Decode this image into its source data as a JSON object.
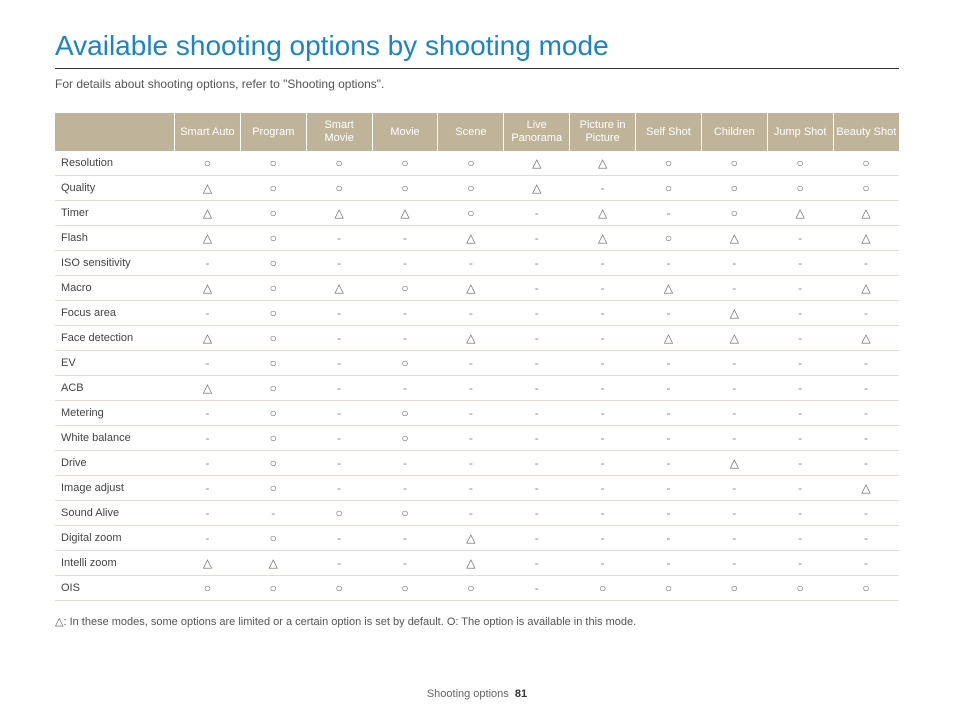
{
  "title": "Available shooting options by shooting mode",
  "subtitle": "For details about shooting options, refer to \"Shooting options\".",
  "columns": [
    "Smart Auto",
    "Program",
    "Smart Movie",
    "Movie",
    "Scene",
    "Live Panorama",
    "Picture in Picture",
    "Self Shot",
    "Children",
    "Jump Shot",
    "Beauty Shot"
  ],
  "rows": [
    {
      "label": "Resolution",
      "cells": [
        "O",
        "O",
        "O",
        "O",
        "O",
        "T",
        "T",
        "O",
        "O",
        "O",
        "O"
      ]
    },
    {
      "label": "Quality",
      "cells": [
        "T",
        "O",
        "O",
        "O",
        "O",
        "T",
        "-",
        "O",
        "O",
        "O",
        "O"
      ]
    },
    {
      "label": "Timer",
      "cells": [
        "T",
        "O",
        "T",
        "T",
        "O",
        "-",
        "T",
        "-",
        "O",
        "T",
        "T"
      ]
    },
    {
      "label": "Flash",
      "cells": [
        "T",
        "O",
        "-",
        "-",
        "T",
        "-",
        "T",
        "O",
        "T",
        "-",
        "T"
      ]
    },
    {
      "label": "ISO sensitivity",
      "cells": [
        "-",
        "O",
        "-",
        "-",
        "-",
        "-",
        "-",
        "-",
        "-",
        "-",
        "-"
      ]
    },
    {
      "label": "Macro",
      "cells": [
        "T",
        "O",
        "T",
        "O",
        "T",
        "-",
        "-",
        "T",
        "-",
        "-",
        "T"
      ]
    },
    {
      "label": "Focus area",
      "cells": [
        "-",
        "O",
        "-",
        "-",
        "-",
        "-",
        "-",
        "-",
        "T",
        "-",
        "-"
      ]
    },
    {
      "label": "Face detection",
      "cells": [
        "T",
        "O",
        "-",
        "-",
        "T",
        "-",
        "-",
        "T",
        "T",
        "-",
        "T"
      ]
    },
    {
      "label": "EV",
      "cells": [
        "-",
        "O",
        "-",
        "O",
        "-",
        "-",
        "-",
        "-",
        "-",
        "-",
        "-"
      ]
    },
    {
      "label": "ACB",
      "cells": [
        "T",
        "O",
        "-",
        "-",
        "-",
        "-",
        "-",
        "-",
        "-",
        "-",
        "-"
      ]
    },
    {
      "label": "Metering",
      "cells": [
        "-",
        "O",
        "-",
        "O",
        "-",
        "-",
        "-",
        "-",
        "-",
        "-",
        "-"
      ]
    },
    {
      "label": "White balance",
      "cells": [
        "-",
        "O",
        "-",
        "O",
        "-",
        "-",
        "-",
        "-",
        "-",
        "-",
        "-"
      ]
    },
    {
      "label": "Drive",
      "cells": [
        "-",
        "O",
        "-",
        "-",
        "-",
        "-",
        "-",
        "-",
        "T",
        "-",
        "-"
      ]
    },
    {
      "label": "Image adjust",
      "cells": [
        "-",
        "O",
        "-",
        "-",
        "-",
        "-",
        "-",
        "-",
        "-",
        "-",
        "T"
      ]
    },
    {
      "label": "Sound Alive",
      "cells": [
        "-",
        "-",
        "O",
        "O",
        "-",
        "-",
        "-",
        "-",
        "-",
        "-",
        "-"
      ]
    },
    {
      "label": "Digital zoom",
      "cells": [
        "-",
        "O",
        "-",
        "-",
        "T",
        "-",
        "-",
        "-",
        "-",
        "-",
        "-"
      ]
    },
    {
      "label": "Intelli zoom",
      "cells": [
        "T",
        "T",
        "-",
        "-",
        "T",
        "-",
        "-",
        "-",
        "-",
        "-",
        "-"
      ]
    },
    {
      "label": "OIS",
      "cells": [
        "O",
        "O",
        "O",
        "O",
        "O",
        "-",
        "O",
        "O",
        "O",
        "O",
        "O"
      ]
    }
  ],
  "legend": "△: In these modes, some options are limited or a certain option is set by default. O: The option is available in this mode.",
  "footer": {
    "section": "Shooting options",
    "page": "81"
  }
}
